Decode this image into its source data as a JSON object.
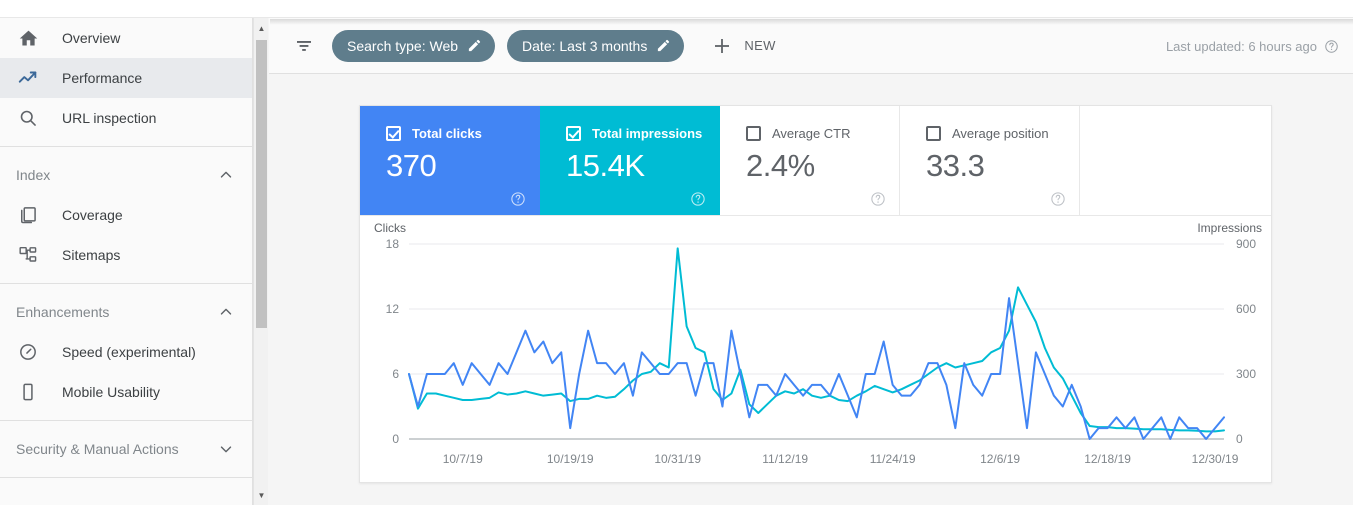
{
  "sidebar": {
    "primary": [
      {
        "label": "Overview",
        "icon": "home-icon",
        "active": false
      },
      {
        "label": "Performance",
        "icon": "trending-up-icon",
        "active": true
      },
      {
        "label": "URL inspection",
        "icon": "search-icon",
        "active": false
      }
    ],
    "sections": [
      {
        "title": "Index",
        "expanded": true,
        "items": [
          {
            "label": "Coverage",
            "icon": "pages-icon"
          },
          {
            "label": "Sitemaps",
            "icon": "sitemap-icon"
          }
        ]
      },
      {
        "title": "Enhancements",
        "expanded": true,
        "items": [
          {
            "label": "Speed (experimental)",
            "icon": "speedometer-icon"
          },
          {
            "label": "Mobile Usability",
            "icon": "mobile-phone-icon"
          }
        ]
      },
      {
        "title": "Security & Manual Actions",
        "expanded": false,
        "items": []
      }
    ]
  },
  "toolbar": {
    "filter_icon": "funnel-icon",
    "chips": [
      {
        "label": "Search type: Web",
        "edit_icon": "pencil-icon"
      },
      {
        "label": "Date: Last 3 months",
        "edit_icon": "pencil-icon"
      }
    ],
    "new_label": "NEW",
    "new_icon": "plus-icon",
    "last_updated": "Last updated: 6 hours ago",
    "last_updated_icon": "help-circle-icon"
  },
  "metrics": [
    {
      "label": "Total clicks",
      "value": "370",
      "checked": true,
      "state": "clicks",
      "help_icon": "help-circle-icon",
      "color": "#4285f4"
    },
    {
      "label": "Total impressions",
      "value": "15.4K",
      "checked": true,
      "state": "impressions",
      "help_icon": "help-circle-icon",
      "color": "#00bcd4"
    },
    {
      "label": "Average CTR",
      "value": "2.4%",
      "checked": false,
      "state": "plain",
      "help_icon": "help-circle-icon",
      "color": "#5f6368"
    },
    {
      "label": "Average position",
      "value": "33.3",
      "checked": false,
      "state": "plain",
      "help_icon": "help-circle-icon",
      "color": "#5f6368"
    }
  ],
  "chart_data": {
    "type": "line",
    "title": "",
    "ylabel": "Clicks",
    "y2label": "Impressions",
    "xlabel": "",
    "grid": true,
    "legend": "none",
    "ylim": [
      0,
      18
    ],
    "y2lim": [
      0,
      900
    ],
    "yticks": [
      "0",
      "6",
      "12",
      "18"
    ],
    "y2ticks": [
      "0",
      "300",
      "600",
      "900"
    ],
    "xticks": [
      "10/7/19",
      "10/19/19",
      "10/31/19",
      "11/12/19",
      "11/24/19",
      "12/6/19",
      "12/18/19",
      "12/30/19"
    ],
    "xtick_indices": [
      6,
      18,
      30,
      42,
      54,
      66,
      78,
      90
    ],
    "x_start": "10/1/19",
    "x_end": "12/31/19",
    "n_points": 92,
    "series": [
      {
        "name": "Clicks",
        "color": "#4285f4",
        "axis": "left",
        "values": [
          6,
          3,
          6,
          6,
          6,
          7,
          5,
          7,
          6,
          5,
          7,
          6,
          8,
          10,
          8,
          9,
          7,
          8,
          1,
          6,
          10,
          7,
          7,
          6,
          7,
          4,
          8,
          7,
          6,
          6,
          7,
          7,
          4,
          7,
          7,
          3,
          10,
          6,
          2,
          5,
          5,
          4,
          6,
          5,
          4,
          5,
          5,
          4,
          6,
          4,
          2,
          6,
          6,
          9,
          5,
          4,
          4,
          5,
          7,
          7,
          5,
          1,
          7,
          5,
          4,
          6,
          6,
          13,
          7,
          1,
          8,
          6,
          4,
          3,
          5,
          3,
          0,
          1,
          1,
          2,
          1,
          2,
          0,
          1,
          2,
          0,
          2,
          1,
          1,
          0,
          1,
          2
        ]
      },
      {
        "name": "Impressions",
        "color": "#00bcd4",
        "axis": "right",
        "values": [
          300,
          140,
          210,
          210,
          200,
          190,
          180,
          180,
          185,
          190,
          215,
          205,
          210,
          220,
          210,
          200,
          205,
          210,
          175,
          185,
          185,
          200,
          190,
          195,
          230,
          270,
          300,
          310,
          350,
          330,
          880,
          520,
          420,
          400,
          230,
          180,
          210,
          320,
          160,
          120,
          160,
          200,
          220,
          210,
          230,
          200,
          190,
          200,
          180,
          175,
          200,
          220,
          245,
          230,
          215,
          230,
          250,
          270,
          300,
          330,
          350,
          330,
          340,
          350,
          360,
          400,
          420,
          500,
          700,
          620,
          540,
          420,
          330,
          280,
          200,
          120,
          60,
          55,
          55,
          50,
          50,
          48,
          45,
          45,
          45,
          42,
          40,
          40,
          38,
          35,
          35,
          40
        ]
      }
    ]
  }
}
